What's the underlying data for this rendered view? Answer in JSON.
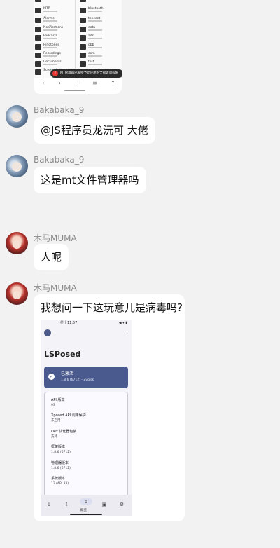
{
  "file_manager": {
    "left_files": [
      "MTR",
      "Alarms",
      "Notifications",
      "Podcasts",
      "Ringtones",
      "Recordings",
      "Documents",
      "Screenshots"
    ],
    "right_files": [
      "bluetooth",
      "tencent",
      "data",
      "ads",
      "obb",
      "com",
      "test"
    ],
    "toast_text": "MT管理器已被授予此应用的全部访问权限",
    "nav_icons": [
      "‹",
      "›",
      "+",
      "≡",
      "↑"
    ]
  },
  "messages": [
    {
      "nickname": "Bakabaka_9",
      "text": "@JS程序员龙沅可 大佬"
    },
    {
      "nickname": "Bakabaka_9",
      "text": "这是mt文件管理器吗"
    },
    {
      "nickname": "木马MUMA",
      "text": "人呢"
    },
    {
      "nickname": "木马MUMA",
      "text": "我想问一下这玩意儿是病毒吗?"
    }
  ],
  "lsposed": {
    "status_time": "星上11:57",
    "status_icons": "◀ ▾ ▮",
    "menu_icon": "⋮",
    "app_title": "LSPosed",
    "active_title": "已激活",
    "active_sub": "1.8.6 (6712) - Zygisk",
    "info": [
      {
        "label": "API 版本",
        "value": "93"
      },
      {
        "label": "Xposed API 调用保护",
        "value": "未启用"
      },
      {
        "label": "Dex 优化器包装",
        "value": "支持"
      },
      {
        "label": "框架版本",
        "value": "1.8.6 (6712)"
      },
      {
        "label": "管理器版本",
        "value": "1.8.6 (6712)"
      },
      {
        "label": "系统版本",
        "value": "13 (API 33)"
      }
    ],
    "nav_icons": [
      "↓",
      "⇩",
      "⌂",
      "▣",
      "⚙"
    ],
    "nav_home_label": "概览"
  }
}
